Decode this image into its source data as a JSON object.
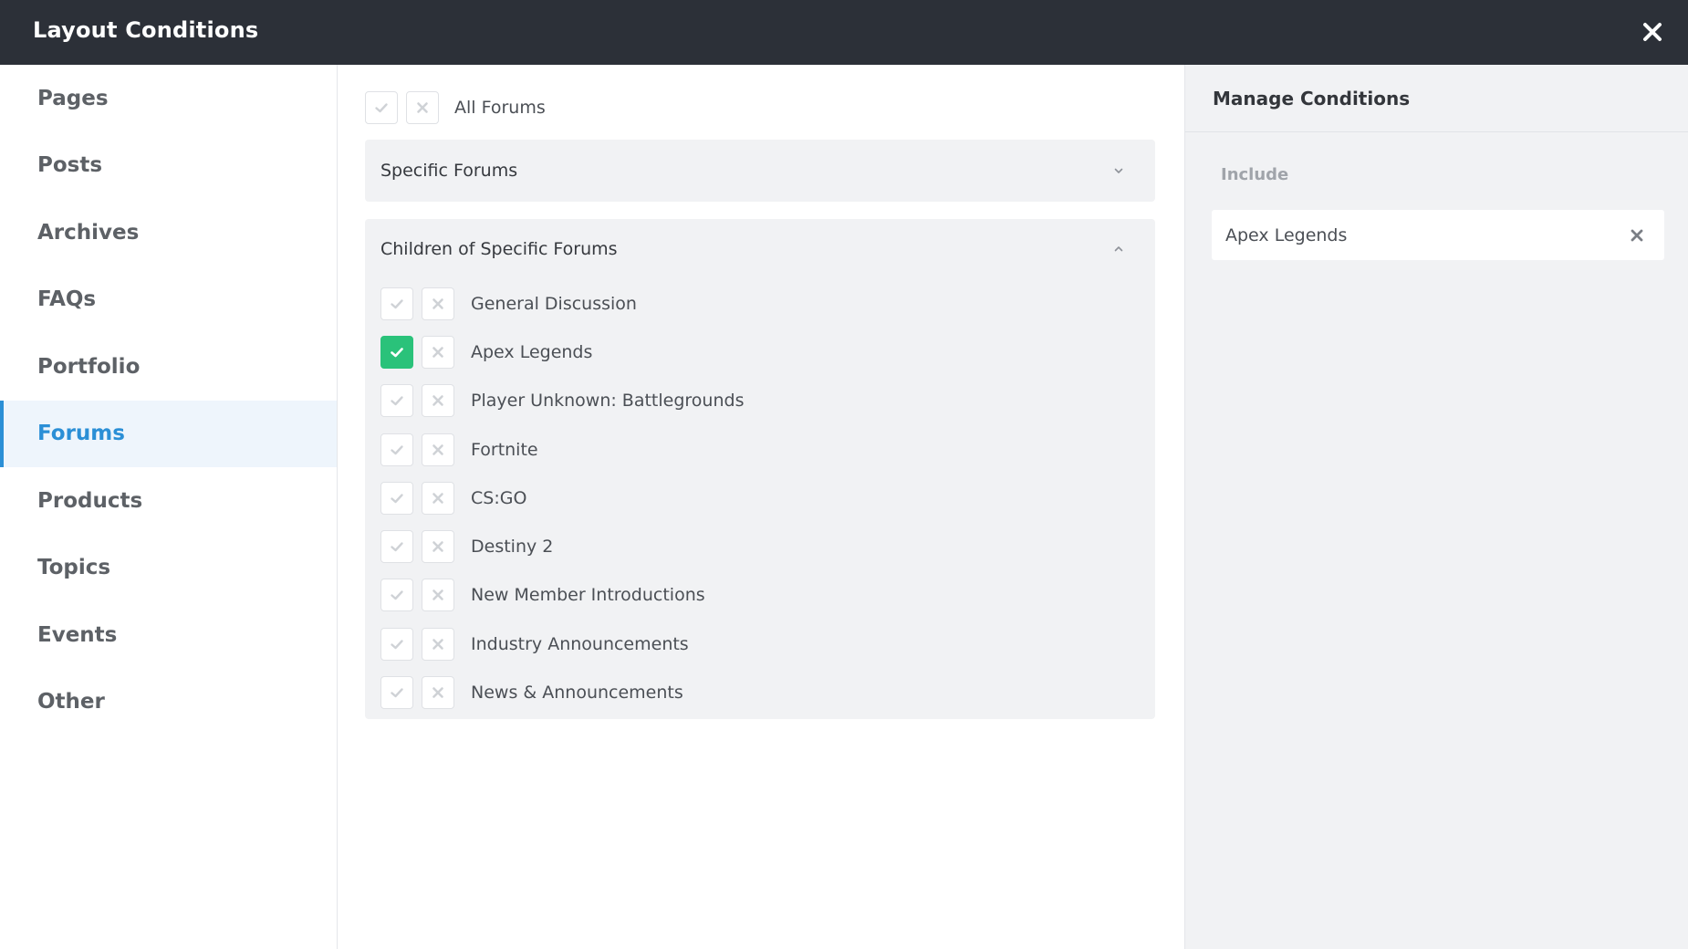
{
  "header": {
    "title": "Layout Conditions",
    "close_icon": "close-icon"
  },
  "sidebar": {
    "items": [
      {
        "label": "Pages"
      },
      {
        "label": "Posts"
      },
      {
        "label": "Archives"
      },
      {
        "label": "FAQs"
      },
      {
        "label": "Portfolio"
      },
      {
        "label": "Forums",
        "active": true
      },
      {
        "label": "Products"
      },
      {
        "label": "Topics"
      },
      {
        "label": "Events"
      },
      {
        "label": "Other"
      }
    ]
  },
  "main": {
    "all_forums": {
      "label": "All Forums",
      "included": false,
      "excluded": false
    },
    "specific_forums": {
      "title": "Specific Forums",
      "expanded": false
    },
    "children_panel": {
      "title": "Children of Specific Forums",
      "expanded": true,
      "items": [
        {
          "label": "General Discussion",
          "included": false
        },
        {
          "label": "Apex Legends",
          "included": true
        },
        {
          "label": "Player Unknown: Battlegrounds",
          "included": false
        },
        {
          "label": "Fortnite",
          "included": false
        },
        {
          "label": "CS:GO",
          "included": false
        },
        {
          "label": "Destiny 2",
          "included": false
        },
        {
          "label": "New Member Introductions",
          "included": false
        },
        {
          "label": "Industry Announcements",
          "included": false
        },
        {
          "label": "News & Announcements",
          "included": false
        }
      ]
    }
  },
  "manage": {
    "title": "Manage Conditions",
    "include_label": "Include",
    "conditions": [
      {
        "label": "Apex Legends"
      }
    ]
  },
  "colors": {
    "header_bg": "#2c3038",
    "accent": "#2b8fd6",
    "include_green": "#2ac27a",
    "panel_bg": "#f1f2f4"
  }
}
